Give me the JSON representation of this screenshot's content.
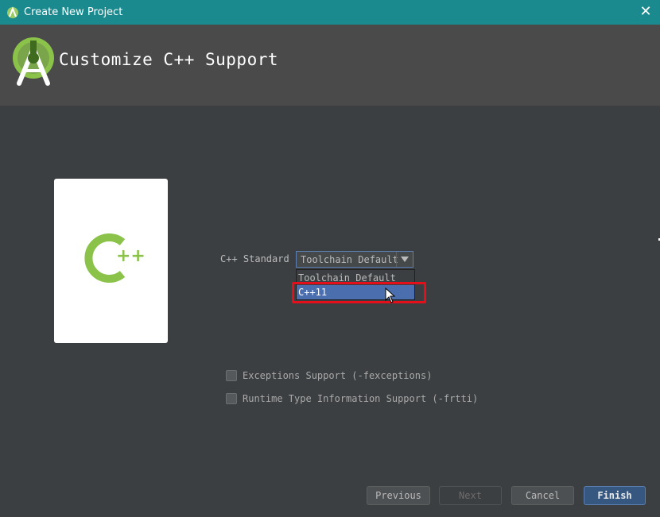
{
  "window": {
    "title": "Create New Project",
    "close_glyph": "✕"
  },
  "header": {
    "heading": "Customize C++ Support",
    "logo_icon": "android-studio-icon"
  },
  "preview": {
    "icon": "cpp-logo-icon",
    "logo_text": "++"
  },
  "form": {
    "standard_label": "C++ Standard",
    "standard_value": "Toolchain Default",
    "standard_options": [
      "Toolchain Default",
      "C++11"
    ],
    "highlighted_option": "C++11",
    "exceptions_label": "Exceptions Support (-fexceptions)",
    "exceptions_checked": false,
    "rtti_label": "Runtime Type Information Support (-frtti)",
    "rtti_checked": false
  },
  "buttons": {
    "previous": "Previous",
    "next": "Next",
    "cancel": "Cancel",
    "finish": "Finish"
  },
  "colors": {
    "titlebar": "#1b8a8f",
    "background": "#3c3f41",
    "header": "#4a4a4a",
    "selection": "#4b6eaf",
    "annotation_red": "#e3101c",
    "cpp_green": "#8bc34a"
  }
}
